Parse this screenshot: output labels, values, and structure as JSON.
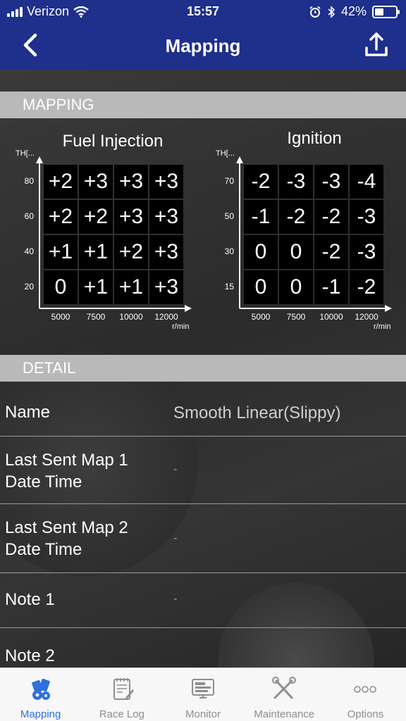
{
  "status_bar": {
    "carrier": "Verizon",
    "time": "15:57",
    "battery": "42%",
    "battery_level": 0.42
  },
  "nav": {
    "title": "Mapping"
  },
  "mapping": {
    "header": "MAPPING",
    "fuel": {
      "title": "Fuel Injection",
      "y_axis_label": "TH[...",
      "y_ticks": [
        "80",
        "60",
        "40",
        "20"
      ],
      "x_ticks": [
        "5000",
        "7500",
        "10000",
        "12000"
      ],
      "x_unit": "r/min",
      "rows": [
        [
          "+2",
          "+3",
          "+3",
          "+3"
        ],
        [
          "+2",
          "+2",
          "+3",
          "+3"
        ],
        [
          "+1",
          "+1",
          "+2",
          "+3"
        ],
        [
          "0",
          "+1",
          "+1",
          "+3"
        ]
      ]
    },
    "ignition": {
      "title": "Ignition",
      "y_axis_label": "TH[...",
      "y_ticks": [
        "70",
        "50",
        "30",
        "15"
      ],
      "x_ticks": [
        "5000",
        "7500",
        "10000",
        "12000"
      ],
      "x_unit": "r/min",
      "rows": [
        [
          "-2",
          "-3",
          "-3",
          "-4"
        ],
        [
          "-1",
          "-2",
          "-2",
          "-3"
        ],
        [
          "0",
          "0",
          "-2",
          "-3"
        ],
        [
          "0",
          "0",
          "-1",
          "-2"
        ]
      ]
    }
  },
  "detail": {
    "header": "DETAIL",
    "name_label": "Name",
    "name_value": "Smooth Linear(Slippy)",
    "map1_label_line1": "Last Sent Map 1",
    "map1_label_line2": "Date Time",
    "map1_value": "-",
    "map2_label_line1": "Last Sent Map 2",
    "map2_label_line2": "Date Time",
    "map2_value": "-",
    "note1_label": "Note 1",
    "note1_value": "-",
    "note2_label": "Note 2"
  },
  "tabbar": {
    "tabs": [
      {
        "label": "Mapping",
        "icon": "engine-icon",
        "active": true
      },
      {
        "label": "Race Log",
        "icon": "notepad-icon",
        "active": false
      },
      {
        "label": "Monitor",
        "icon": "monitor-icon",
        "active": false
      },
      {
        "label": "Maintenance",
        "icon": "tools-icon",
        "active": false
      },
      {
        "label": "Options",
        "icon": "more-icon",
        "active": false
      }
    ]
  },
  "colors": {
    "nav_blue": "#1e2f8c",
    "section_gray": "#b9b9b9",
    "tab_active": "#2f6fde",
    "tab_inactive": "#8e8e8e"
  }
}
